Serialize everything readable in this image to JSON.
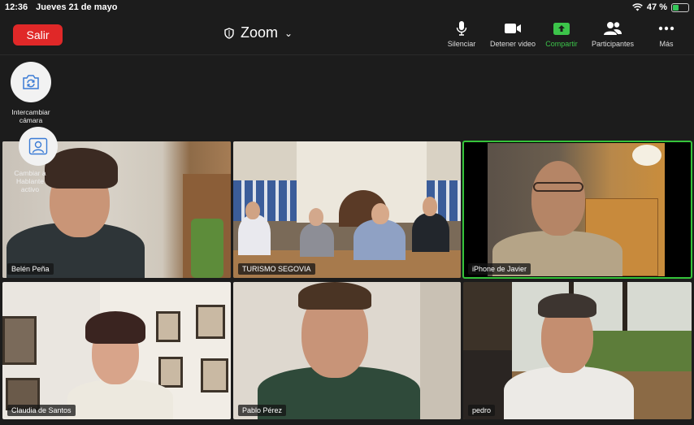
{
  "status_bar": {
    "time": "12:36",
    "date": "Jueves 21 de mayo",
    "battery_percent": "47 %",
    "battery_level": 0.47
  },
  "toolbar": {
    "leave_label": "Salir",
    "app_title": "Zoom",
    "items": [
      {
        "label": "Silenciar",
        "icon": "microphone-icon"
      },
      {
        "label": "Detener video",
        "icon": "video-camera-icon"
      },
      {
        "label": "Compartir",
        "icon": "share-screen-icon"
      },
      {
        "label": "Participantes",
        "icon": "participants-icon"
      },
      {
        "label": "Más",
        "icon": "more-icon"
      }
    ]
  },
  "overlay": {
    "switch_camera_line1": "Intercambiar",
    "switch_camera_line2": "cámara",
    "active_speaker_line1": "Cambiar a",
    "active_speaker_line2": "Hablante",
    "active_speaker_line3": "activo"
  },
  "participants": [
    {
      "name": "Belén Peña"
    },
    {
      "name": "TURISMO SEGOVIA"
    },
    {
      "name": "iPhone de Javier"
    },
    {
      "name": "Claudia de Santos"
    },
    {
      "name": "Pablo Pérez"
    },
    {
      "name": "pedro"
    }
  ],
  "colors": {
    "leave_button": "#e02828",
    "active_speaker_border": "#35c33a",
    "share_green": "#3cc44a"
  }
}
